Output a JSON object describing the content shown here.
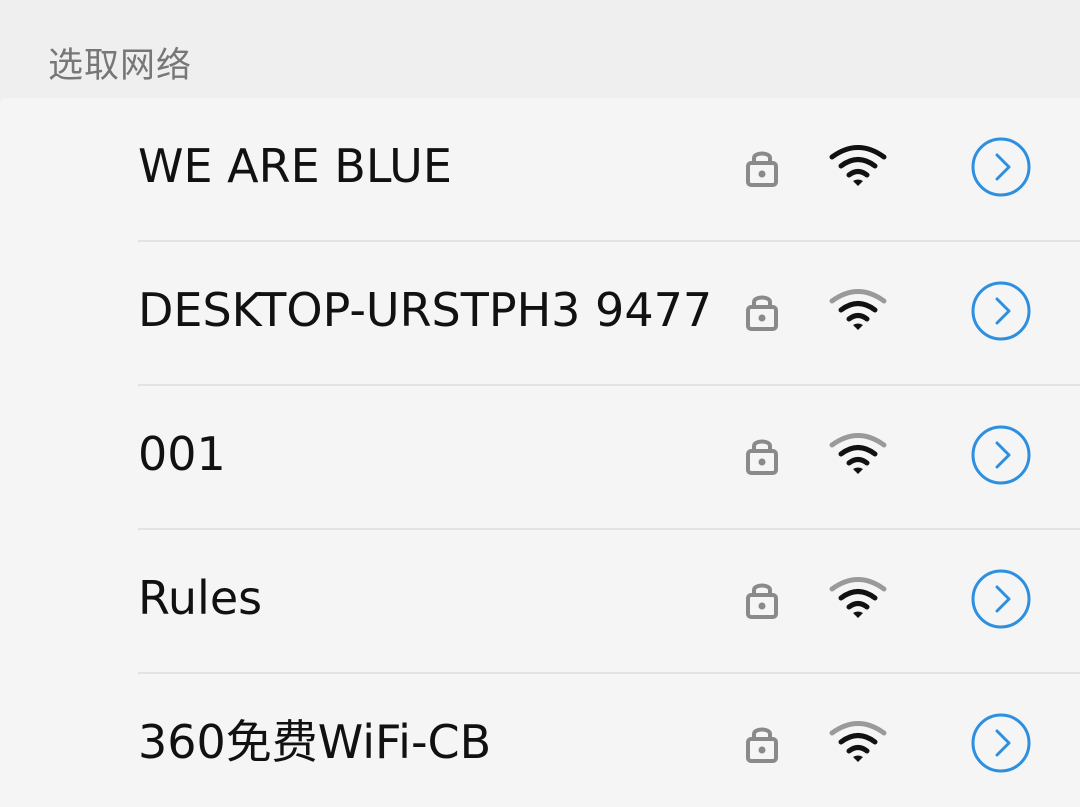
{
  "header": {
    "title": "选取网络"
  },
  "networks": [
    {
      "ssid": "WE ARE BLUE",
      "secured": true,
      "signal": "full",
      "signal_bars": 3
    },
    {
      "ssid": "DESKTOP-URSTPH3 9477",
      "secured": true,
      "signal": "medium",
      "signal_bars": 2
    },
    {
      "ssid": "001",
      "secured": true,
      "signal": "medium",
      "signal_bars": 2
    },
    {
      "ssid": "Rules",
      "secured": true,
      "signal": "medium",
      "signal_bars": 2
    },
    {
      "ssid": "360免费WiFi-CB",
      "secured": true,
      "signal": "medium",
      "signal_bars": 2
    }
  ],
  "icons": {
    "lock": "lock-icon",
    "wifi": "wifi-signal-icon",
    "detail": "info-chevron-icon"
  },
  "colors": {
    "accent": "#2d8fe0",
    "lock": "#8a8a8a",
    "signal_active": "#111111",
    "signal_inactive": "#9a9a9a",
    "background": "#f5f5f5",
    "header_background": "#efefef"
  }
}
